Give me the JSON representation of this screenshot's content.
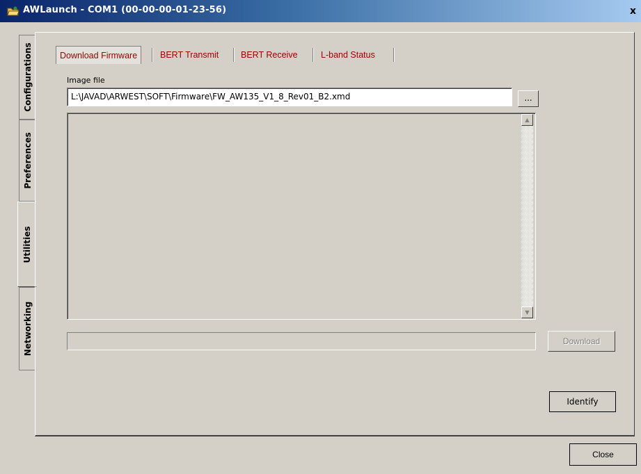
{
  "window": {
    "title": "AWLaunch - COM1  (00-00-00-01-23-56)",
    "close_glyph": "x"
  },
  "side_tabs": [
    {
      "label": "Configurations",
      "active": false
    },
    {
      "label": "Preferences",
      "active": false
    },
    {
      "label": "Utilities",
      "active": true
    },
    {
      "label": "Networking",
      "active": false
    }
  ],
  "tabs": [
    {
      "label": "Download Firmware",
      "active": true
    },
    {
      "label": "BERT Transmit",
      "active": false
    },
    {
      "label": "BERT Receive",
      "active": false
    },
    {
      "label": "L-band Status",
      "active": false
    }
  ],
  "image_file": {
    "label": "Image file",
    "value": "L:\\JAVAD\\ARWEST\\SOFT\\Firmware\\FW_AW135_V1_8_Rev01_B2.xmd",
    "browse_label": "..."
  },
  "buttons": {
    "download": "Download",
    "identify": "Identify",
    "close": "Close"
  },
  "progress": {
    "value": 0
  },
  "icons": {
    "app": "folder-app-icon",
    "scroll_up": "scroll-up-arrow-icon",
    "scroll_down": "scroll-down-arrow-icon"
  },
  "colors": {
    "tab_text": "#a00000",
    "titlebar_start": "#0a246a",
    "titlebar_end": "#a6caf0",
    "face": "#d4d0c8"
  }
}
